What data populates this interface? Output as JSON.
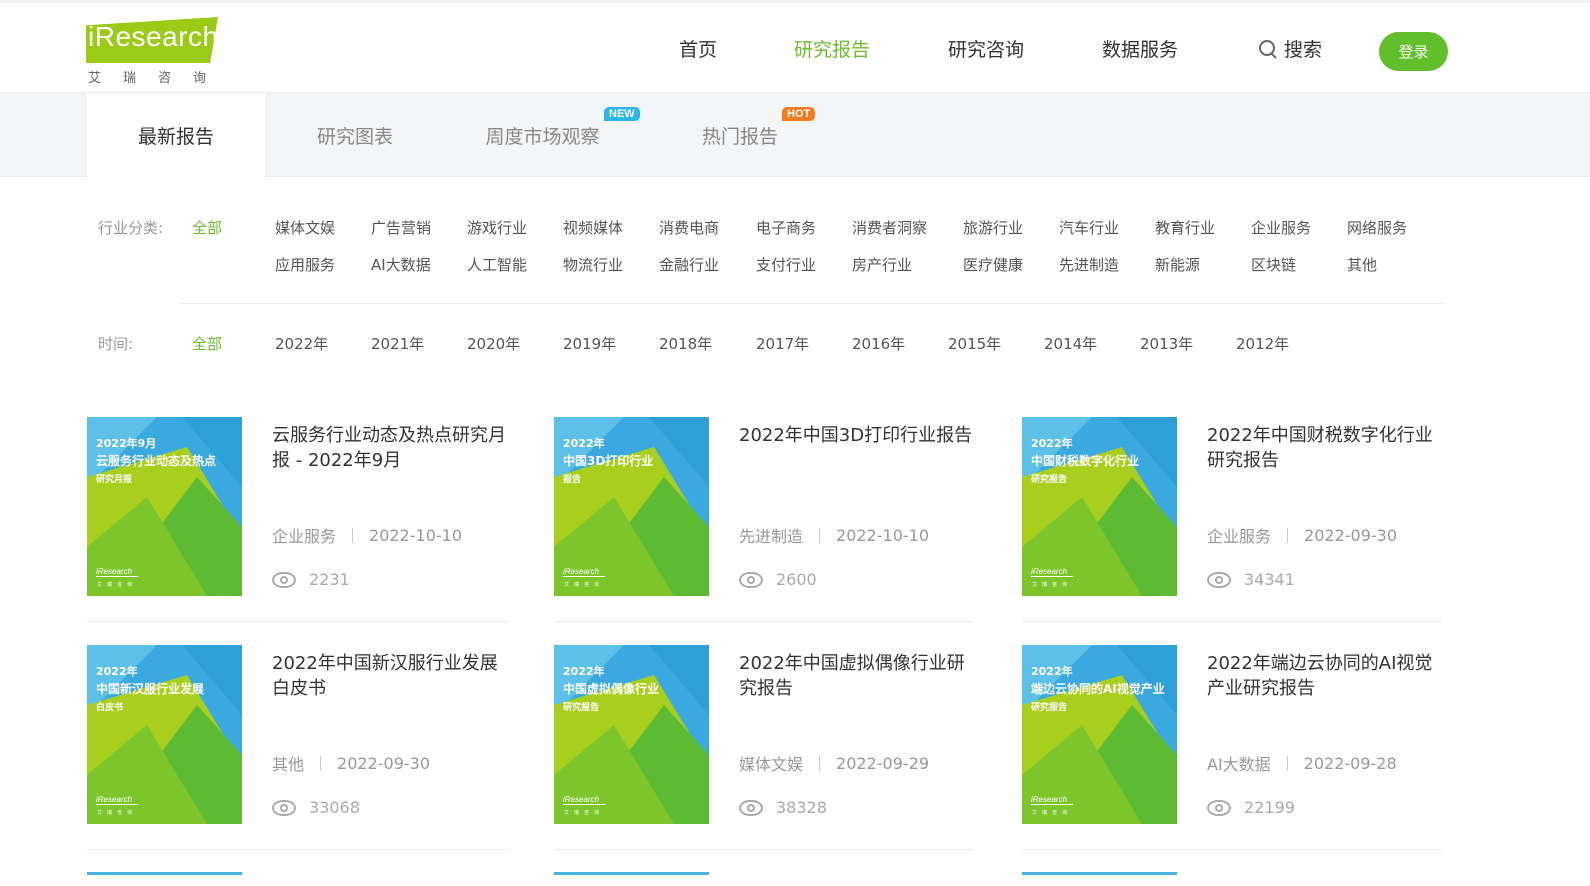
{
  "brand": {
    "logo_text": "iResearch",
    "logo_sub": "艾瑞咨询"
  },
  "nav": {
    "items": [
      "首页",
      "研究报告",
      "研究咨询",
      "数据服务"
    ],
    "active_index": 1,
    "search_label": "搜索",
    "login_label": "登录"
  },
  "tabs": {
    "items": [
      {
        "label": "最新报告",
        "badge": ""
      },
      {
        "label": "研究图表",
        "badge": ""
      },
      {
        "label": "周度市场观察",
        "badge": "NEW"
      },
      {
        "label": "热门报告",
        "badge": "HOT"
      }
    ],
    "active_index": 0
  },
  "filters": {
    "industry_label": "行业分类:",
    "industry_options": [
      "全部",
      "媒体文娱",
      "广告营销",
      "游戏行业",
      "视频媒体",
      "消费电商",
      "电子商务",
      "消费者洞察",
      "旅游行业",
      "汽车行业",
      "教育行业",
      "企业服务",
      "网络服务",
      "应用服务",
      "AI大数据",
      "人工智能",
      "物流行业",
      "金融行业",
      "支付行业",
      "房产行业",
      "医疗健康",
      "先进制造",
      "新能源",
      "区块链",
      "其他"
    ],
    "time_label": "时间:",
    "time_options": [
      "全部",
      "2022年",
      "2021年",
      "2020年",
      "2019年",
      "2018年",
      "2017年",
      "2016年",
      "2015年",
      "2014年",
      "2013年",
      "2012年"
    ]
  },
  "reports": [
    {
      "title": "云服务行业动态及热点研究月报 - 2022年9月",
      "category": "企业服务",
      "date": "2022-10-10",
      "views": "2231",
      "cover_year": "2022年9月",
      "cover_title": "云服务行业动态及热点",
      "cover_sub": "研究月报"
    },
    {
      "title": "2022年中国3D打印行业报告",
      "category": "先进制造",
      "date": "2022-10-10",
      "views": "2600",
      "cover_year": "2022年",
      "cover_title": "中国3D打印行业",
      "cover_sub": "报告"
    },
    {
      "title": "2022年中国财税数字化行业研究报告",
      "category": "企业服务",
      "date": "2022-09-30",
      "views": "34341",
      "cover_year": "2022年",
      "cover_title": "中国财税数字化行业",
      "cover_sub": "研究报告"
    },
    {
      "title": "2022年中国新汉服行业发展白皮书",
      "category": "其他",
      "date": "2022-09-30",
      "views": "33068",
      "cover_year": "2022年",
      "cover_title": "中国新汉服行业发展",
      "cover_sub": "白皮书"
    },
    {
      "title": "2022年中国虚拟偶像行业研究报告",
      "category": "媒体文娱",
      "date": "2022-09-29",
      "views": "38328",
      "cover_year": "2022年",
      "cover_title": "中国虚拟偶像行业",
      "cover_sub": "研究报告"
    },
    {
      "title": "2022年端边云协同的AI视觉产业研究报告",
      "category": "AI大数据",
      "date": "2022-09-28",
      "views": "22199",
      "cover_year": "2022年",
      "cover_title": "端边云协同的AI视觉产业",
      "cover_sub": "研究报告"
    }
  ],
  "cover_logo": {
    "text": "iResearch",
    "sub": "艾瑞咨询"
  },
  "colors": {
    "accent": "#6cbe2e",
    "login_bg": "#62bf2c",
    "new_badge": "#2cb6e8",
    "hot_badge": "#f37b1d",
    "cover_blue": "#3aa9e0",
    "cover_green": "#5dbb33",
    "cover_lime": "#a9cf1e"
  }
}
